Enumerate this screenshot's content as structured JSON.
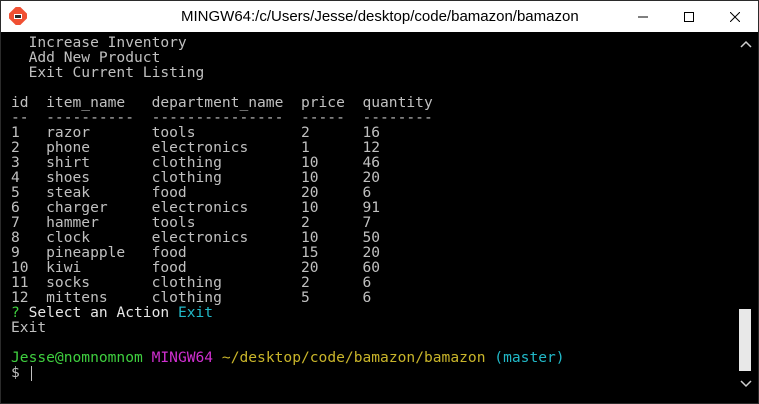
{
  "window": {
    "title": "MINGW64:/c/Users/Jesse/desktop/code/bamazon/bamazon",
    "icon": "git-bash-icon",
    "controls": [
      "minimize-icon",
      "maximize-icon",
      "close-icon"
    ]
  },
  "menu_tail": [
    "  Increase Inventory",
    "  Add New Product",
    "  Exit Current Listing"
  ],
  "table": {
    "header": "id  item_name   department_name  price  quantity",
    "divider": "--  ----------  ---------------  -----  --------",
    "rows": [
      "1   razor       tools            2      16",
      "2   phone       electronics      1      12",
      "3   shirt       clothing         10     46",
      "4   shoes       clothing         10     20",
      "5   steak       food             20     6",
      "6   charger     electronics      10     91",
      "7   hammer      tools            2      7",
      "8   clock       electronics      10     50",
      "9   pineapple   food             15     20",
      "10  kiwi        food             20     60",
      "11  socks       clothing         2      6",
      "12  mittens     clothing         5      6"
    ]
  },
  "prompt_result": {
    "question_mark": "?",
    "question": " Select an Action ",
    "answer": "Exit",
    "echo": "Exit"
  },
  "shell_prompt": {
    "user_host": "Jesse@nomnomnom",
    "env": "MINGW64",
    "path": "~/desktop/code/bamazon/bamazon",
    "branch": "(master)",
    "symbol": "$"
  },
  "colors": {
    "green": "#3fcf3f",
    "cyan": "#21b8c7",
    "magenta": "#d02fd0",
    "yellow": "#c9b52a",
    "text": "#c0c0c0"
  }
}
